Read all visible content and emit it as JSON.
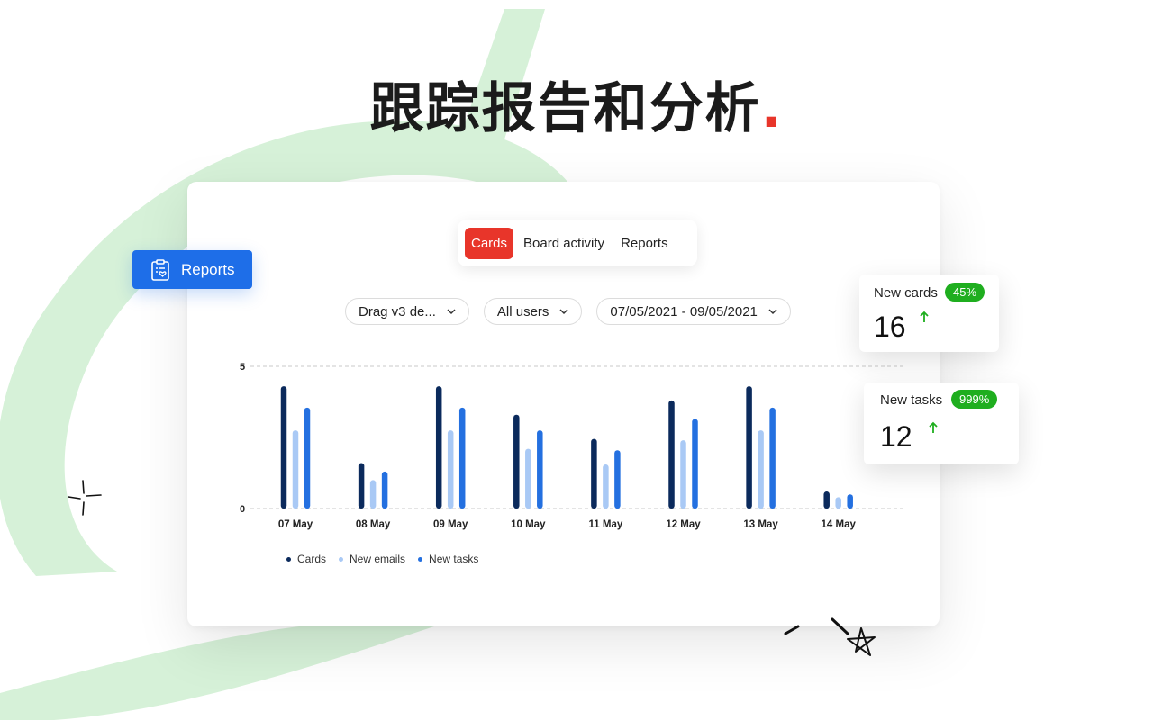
{
  "headline": {
    "text": "跟踪报告和分析",
    "dot": "."
  },
  "tabs": [
    {
      "label": "Cards",
      "active": true
    },
    {
      "label": "Board activity",
      "active": false
    },
    {
      "label": "Reports",
      "active": false
    }
  ],
  "filters": {
    "board": "Drag v3 de...",
    "users": "All users",
    "date_range": "07/05/2021 - 09/05/2021"
  },
  "side_button": {
    "label": "Reports",
    "icon": "clipboard-heart-icon"
  },
  "stats": {
    "new_cards": {
      "label": "New cards",
      "badge": "45%",
      "value": "16",
      "trend_icon": "arrow-up-icon"
    },
    "new_tasks": {
      "label": "New tasks",
      "badge": "999%",
      "value": "12",
      "trend_icon": "arrow-up-icon"
    }
  },
  "colors": {
    "accent_red": "#e8352a",
    "primary_blue": "#1e6ee8",
    "success_green": "#1fae1f",
    "swoosh_green": "#d6f1d8",
    "cards_series": "#0b2a5c",
    "emails_series": "#a9c9f5",
    "tasks_series": "#2470e0"
  },
  "chart_data": {
    "type": "bar",
    "categories": [
      "07 May",
      "08 May",
      "09 May",
      "10 May",
      "11 May",
      "12 May",
      "13 May",
      "14 May"
    ],
    "yticks": [
      0,
      5
    ],
    "ylim": [
      0,
      5
    ],
    "grid": true,
    "series": [
      {
        "name": "Cards",
        "color": "#0b2a5c",
        "values": [
          4.3,
          1.6,
          4.3,
          3.3,
          2.45,
          3.8,
          4.3,
          0.6
        ]
      },
      {
        "name": "New emails",
        "color": "#a9c9f5",
        "values": [
          2.75,
          1.0,
          2.75,
          2.1,
          1.55,
          2.4,
          2.75,
          0.4
        ]
      },
      {
        "name": "New tasks",
        "color": "#2470e0",
        "values": [
          3.55,
          1.3,
          3.55,
          2.75,
          2.05,
          3.15,
          3.55,
          0.5
        ]
      }
    ],
    "legend_position": "bottom-left"
  }
}
